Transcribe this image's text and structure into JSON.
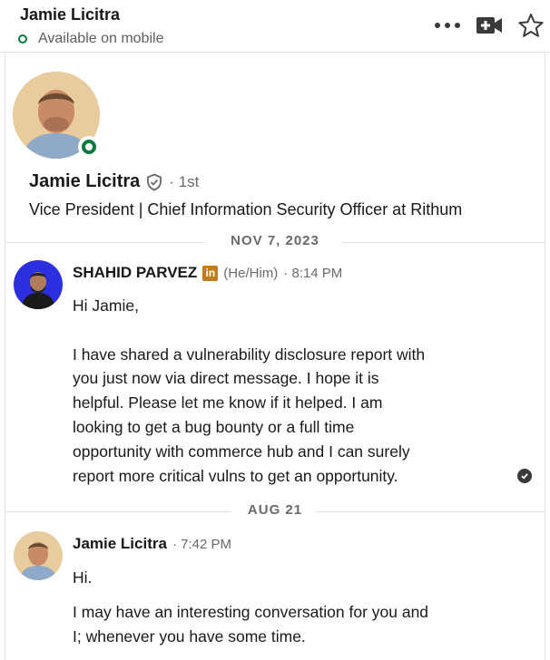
{
  "header": {
    "name": "Jamie Licitra",
    "status": "Available on mobile"
  },
  "profile": {
    "name": "Jamie Licitra",
    "degree": "· 1st",
    "headline": "Vice President | Chief Information Security Officer at Rithum"
  },
  "messages": [
    {
      "date": "NOV 7, 2023",
      "sender": "SHAHID PARVEZ",
      "badge": "in",
      "pronouns": "(He/Him)",
      "time": "· 8:14 PM",
      "lines": [
        "Hi Jamie,",
        "",
        "I have shared a vulnerability disclosure report with",
        "you just now via direct message. I hope it is",
        "helpful. Please let me know if it helped. I am",
        "looking to get a bug bounty or a full time",
        "opportunity with commerce hub and I can surely",
        "report more critical vulns to get an opportunity."
      ],
      "read": true
    },
    {
      "date": "AUG 21",
      "sender": "Jamie Licitra",
      "time": "· 7:42 PM",
      "lines": [
        "Hi.",
        "I may have an interesting conversation for you and",
        "I; whenever you have some time."
      ]
    }
  ],
  "icons": {
    "more": "more-icon",
    "video": "video-call-icon",
    "star": "star-icon",
    "verified": "verified-shield-icon",
    "read": "read-receipt-icon"
  },
  "colors": {
    "online": "#0a7a3e",
    "linkedin_badge": "#c37d16"
  }
}
